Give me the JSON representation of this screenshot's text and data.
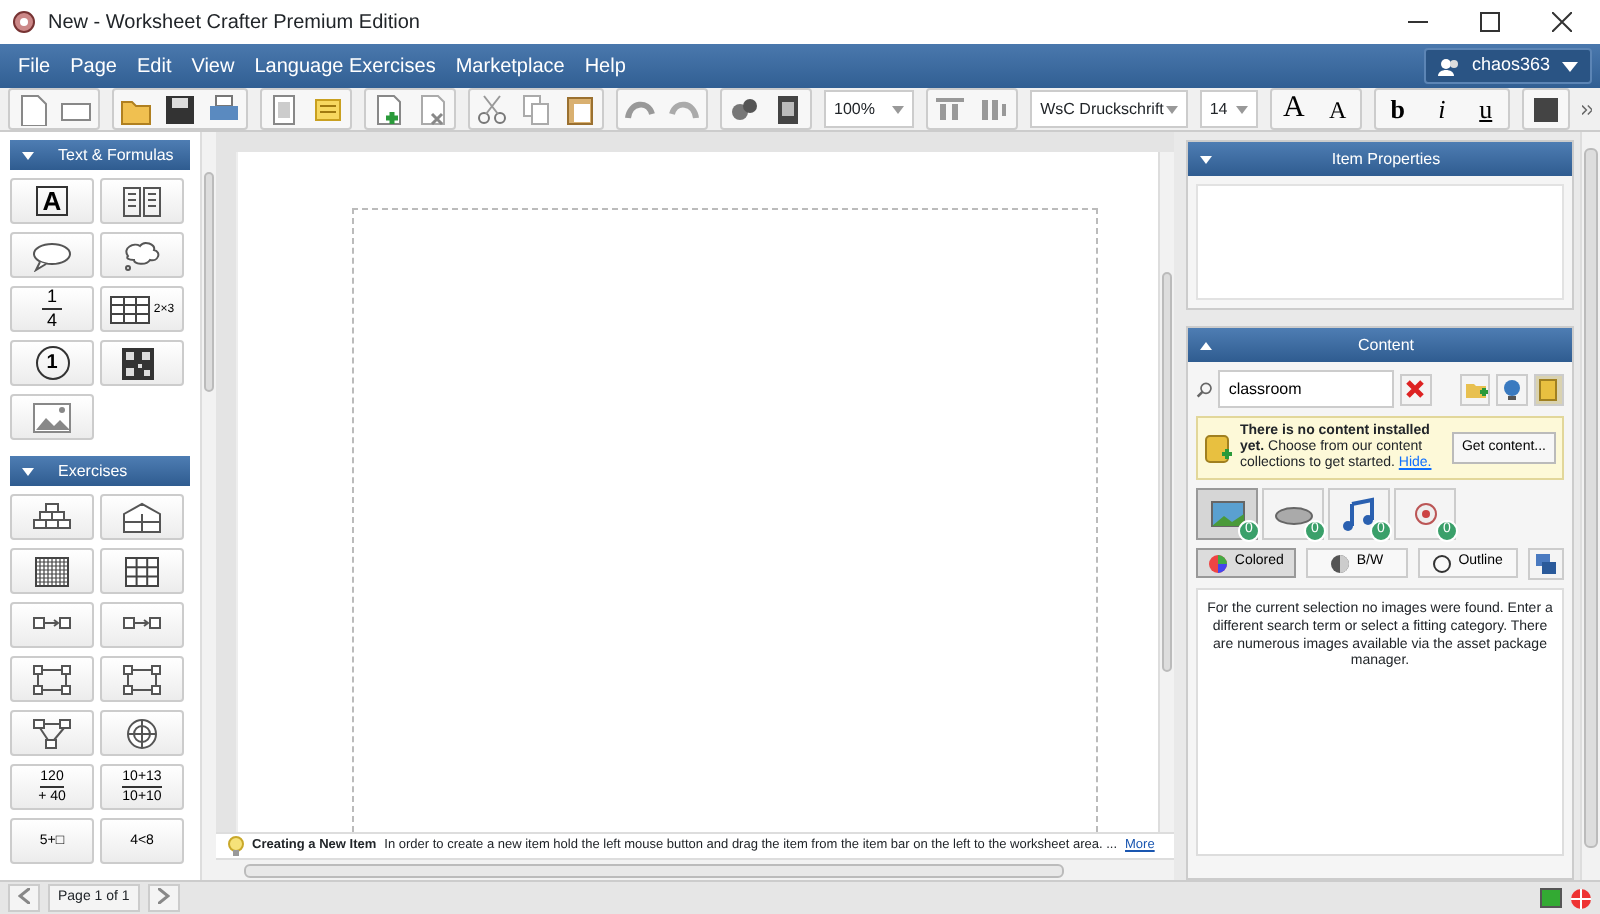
{
  "window": {
    "title": "New - Worksheet Crafter Premium Edition"
  },
  "menu": [
    "File",
    "Page",
    "Edit",
    "View",
    "Language Exercises",
    "Marketplace",
    "Help"
  ],
  "user": {
    "name": "chaos363"
  },
  "toolbar": {
    "groups": [
      [
        {
          "kind": "document"
        },
        {
          "kind": "frame"
        }
      ],
      [
        {
          "kind": "folder"
        },
        {
          "kind": "floppy"
        },
        {
          "kind": "printer"
        }
      ],
      [
        {
          "kind": "page"
        },
        {
          "kind": "note"
        }
      ],
      [
        {
          "kind": "add-page"
        },
        {
          "kind": "remove-page"
        }
      ],
      [
        {
          "kind": "scissors"
        },
        {
          "kind": "copy"
        },
        {
          "kind": "clipboard"
        }
      ],
      [
        {
          "kind": "undo"
        },
        {
          "kind": "redo"
        }
      ],
      [
        {
          "kind": "gears"
        },
        {
          "kind": "book"
        }
      ]
    ],
    "zoom": "100%",
    "font": "WsC Druckschrift",
    "size": "14",
    "grow": "A",
    "shrink": "A",
    "styles": [
      {
        "kind": "bold",
        "label": "b"
      },
      {
        "kind": "italic",
        "label": "i"
      },
      {
        "kind": "underline",
        "label": "u"
      }
    ]
  },
  "sections": [
    {
      "title": "Text & Formulas",
      "expanded": true,
      "tools": [
        {
          "kind": "letter",
          "text": "A"
        },
        {
          "kind": "columns"
        },
        {
          "kind": "speech"
        },
        {
          "kind": "thought"
        },
        {
          "kind": "fraction",
          "lines": [
            "1",
            "4"
          ]
        },
        {
          "kind": "table",
          "text": "2×3"
        },
        {
          "kind": "circled",
          "text": "1"
        },
        {
          "kind": "qr"
        },
        {
          "kind": "image"
        }
      ]
    },
    {
      "title": "Exercises",
      "expanded": true,
      "tools": [
        {
          "kind": "pyramid"
        },
        {
          "kind": "house"
        },
        {
          "kind": "finegrid"
        },
        {
          "kind": "grid"
        },
        {
          "kind": "arrow"
        },
        {
          "kind": "arrow"
        },
        {
          "kind": "square"
        },
        {
          "kind": "square"
        },
        {
          "kind": "flow"
        },
        {
          "kind": "target"
        },
        {
          "kind": "lines",
          "lines": [
            "120",
            "+ 40"
          ]
        },
        {
          "kind": "lines",
          "lines": [
            "10+13",
            "10+10"
          ]
        },
        {
          "kind": "lines",
          "lines": [
            "5+□"
          ]
        },
        {
          "kind": "lines",
          "lines": [
            "4<8"
          ]
        }
      ]
    }
  ],
  "hint": {
    "title": "Creating a New Item",
    "text": "In order to create a new item hold the left mouse button and drag the item from the item bar on the left to the worksheet area. ...",
    "link": "More"
  },
  "status_bar": {
    "page": "Page 1 of 1"
  },
  "item_properties": {
    "title": "Item Properties",
    "expanded": true
  },
  "content": {
    "title": "Content",
    "expanded": true,
    "search": "classroom",
    "notice": {
      "text": "**There is no content installed yet.** Choose from our content collections to get started.",
      "link": "Hide.",
      "button": "Get content..."
    },
    "categories": [
      {
        "kind": "picture",
        "count": "0",
        "selected": true
      },
      {
        "kind": "disc",
        "count": "0",
        "selected": false
      },
      {
        "kind": "music",
        "count": "0",
        "selected": false
      },
      {
        "kind": "media",
        "count": "0",
        "selected": false
      }
    ],
    "filters": [
      {
        "kind": "colored",
        "label": "Colored",
        "selected": true
      },
      {
        "kind": "bw",
        "label": "B/W",
        "selected": false
      },
      {
        "kind": "outline",
        "label": "Outline",
        "selected": false
      }
    ],
    "message": "For the current selection no images were found. Enter a different search term or select a fitting category. There are numerous images available via the asset package manager."
  }
}
